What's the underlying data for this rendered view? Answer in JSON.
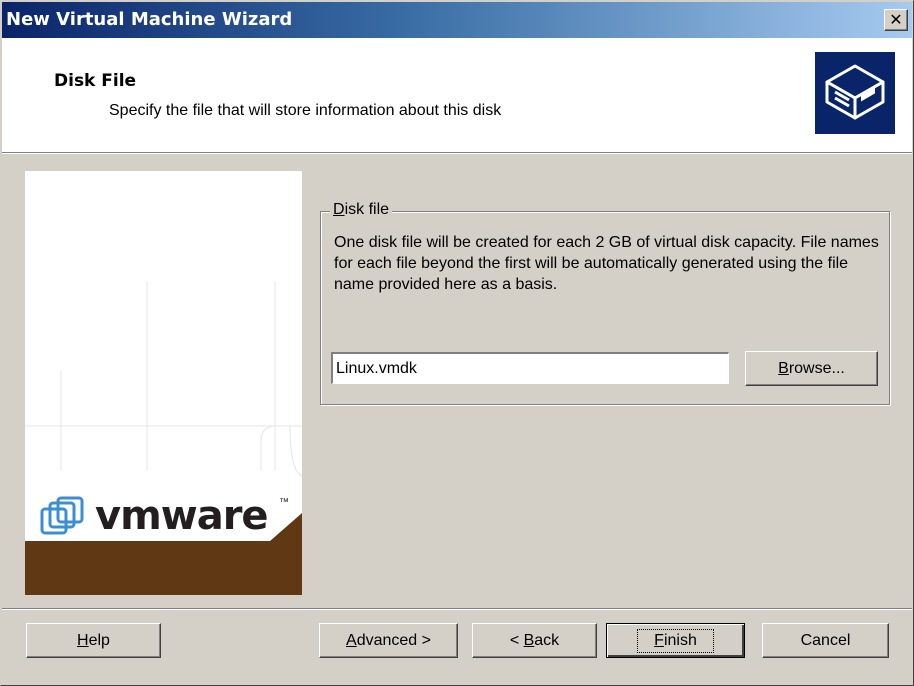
{
  "window": {
    "title": "New Virtual Machine Wizard",
    "close_label": "✕"
  },
  "header": {
    "title": "Disk File",
    "subtitle": "Specify the file that will store information about this disk",
    "icon": "disk-drive-icon"
  },
  "side_panel": {
    "logo_text": "vmware",
    "logo_tm": "™",
    "brand_color": "#603813",
    "logo_blue": "#3b8fd0"
  },
  "disk_file": {
    "group_label_accel": "D",
    "group_label_rest": "isk file",
    "description": "One disk file will be created for each 2 GB of virtual disk capacity. File names for each file beyond the first will be automatically generated using the file name provided here as a basis.",
    "file_name": "Linux.vmdk",
    "browse_accel": "B",
    "browse_rest": "rowse..."
  },
  "footer": {
    "help_accel": "H",
    "help_rest": "elp",
    "advanced_accel": "A",
    "advanced_rest": "dvanced >",
    "back_prefix": "< ",
    "back_accel": "B",
    "back_rest": "ack",
    "finish_accel": "F",
    "finish_rest": "inish",
    "cancel_label": "Cancel"
  }
}
